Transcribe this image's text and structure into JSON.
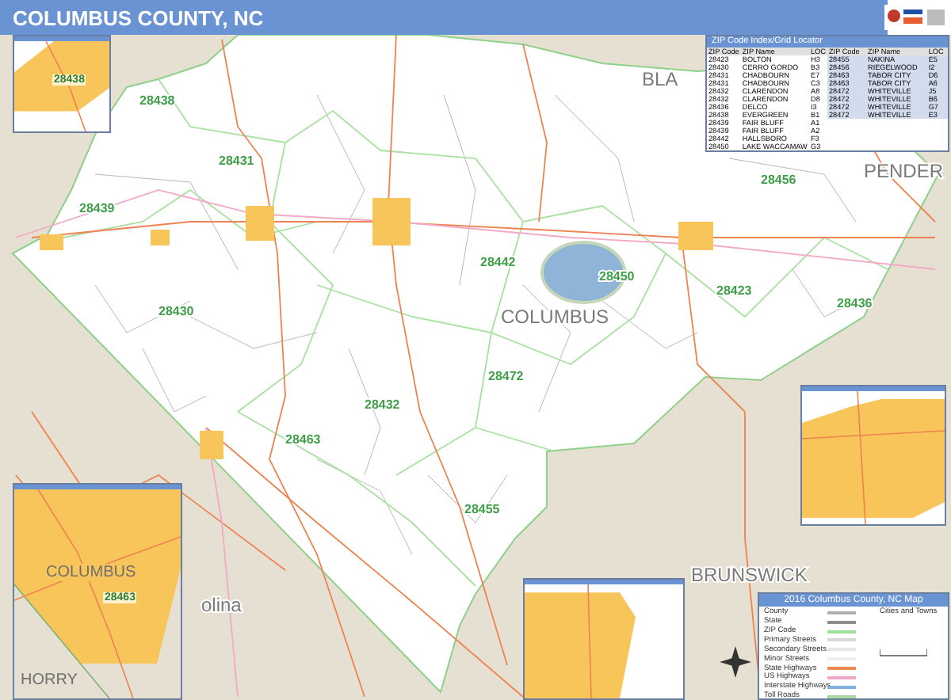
{
  "title": "COLUMBUS COUNTY, NC",
  "zip_index": {
    "title": "ZIP Code Index/Grid Locator",
    "panels": [
      {
        "columns": [
          "ZIP Code",
          "ZIP Name",
          "LOC"
        ],
        "rows": [
          [
            "28423",
            "BOLTON",
            "H3"
          ],
          [
            "28430",
            "CERRO GORDO",
            "B3"
          ],
          [
            "28431",
            "CHADBOURN",
            "E7"
          ],
          [
            "28431",
            "CHADBOURN",
            "C3"
          ],
          [
            "28432",
            "CLARENDON",
            "A8"
          ],
          [
            "28432",
            "CLARENDON",
            "D8"
          ],
          [
            "28436",
            "DELCO",
            "I3"
          ],
          [
            "28438",
            "EVERGREEN",
            "B1"
          ],
          [
            "28439",
            "FAIR BLUFF",
            "A1"
          ],
          [
            "28439",
            "FAIR BLUFF",
            "A2"
          ],
          [
            "28442",
            "HALLSBORO",
            "F3"
          ],
          [
            "28450",
            "LAKE WACCAMAW",
            "G3"
          ]
        ]
      },
      {
        "columns": [
          "ZIP Code",
          "ZIP Name",
          "LOC"
        ],
        "rows": [
          [
            "28455",
            "NAKINA",
            "E5"
          ],
          [
            "28456",
            "RIEGELWOOD",
            "I2"
          ],
          [
            "28463",
            "TABOR CITY",
            "D6"
          ],
          [
            "28463",
            "TABOR CITY",
            "A6"
          ],
          [
            "28472",
            "WHITEVILLE",
            "J5"
          ],
          [
            "28472",
            "WHITEVILLE",
            "B6"
          ],
          [
            "28472",
            "WHITEVILLE",
            "G7"
          ],
          [
            "28472",
            "WHITEVILLE",
            "E3"
          ]
        ]
      }
    ]
  },
  "map": {
    "region_labels": [
      "BLA",
      "PENDER",
      "COLUMBUS",
      "BRUNSWICK",
      "olina"
    ],
    "zip_labels": [
      "28438",
      "28431",
      "28439",
      "28430",
      "28442",
      "28450",
      "28423",
      "28436",
      "28456",
      "28472",
      "28432",
      "28463",
      "28455"
    ]
  },
  "insets": [
    {
      "zip_labels": [
        "28438"
      ]
    },
    {
      "place_labels": [
        "COLUMBUS",
        "HORRY"
      ],
      "zip_labels": [
        "28463"
      ]
    }
  ],
  "legend": {
    "title": "2016 Columbus County, NC Map",
    "towns_title": "Cities and Towns",
    "items": [
      {
        "label": "County",
        "color": "#b0b0b0"
      },
      {
        "label": "State",
        "color": "#8c8c8c"
      },
      {
        "label": "ZIP Code",
        "color": "#9fe09a"
      },
      {
        "label": "Primary Streets",
        "color": "#d8d8d8"
      },
      {
        "label": "Secondary Streets",
        "color": "#e6e6e6"
      },
      {
        "label": "Minor Streets",
        "color": "#efefef"
      },
      {
        "label": "State Highways",
        "color": "#f08a50"
      },
      {
        "label": "US Highways",
        "color": "#f4a6c8"
      },
      {
        "label": "Interstate Highways",
        "color": "#7fb0e0"
      },
      {
        "label": "Toll Roads",
        "color": "#a8d8a0"
      }
    ]
  }
}
